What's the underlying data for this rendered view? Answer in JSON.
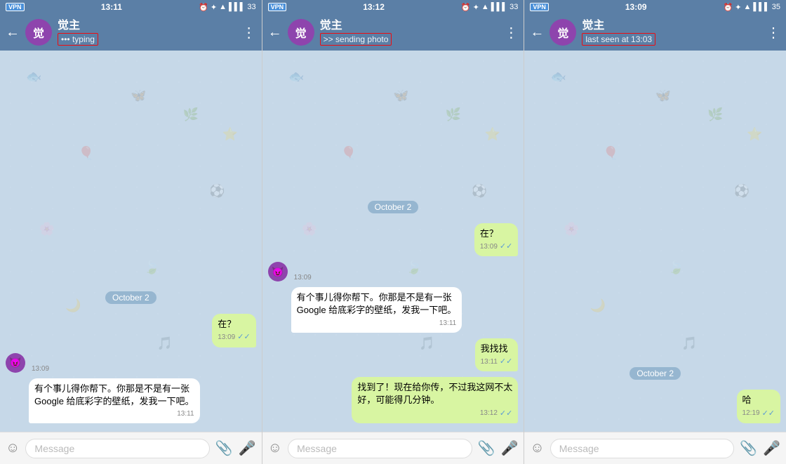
{
  "panels": [
    {
      "id": "panel1",
      "statusBar": {
        "left": "VPN",
        "time": "13:11",
        "right": "33"
      },
      "header": {
        "name": "觉主",
        "avatarChar": "觉",
        "statusText": "••• typing",
        "statusHighlight": true
      },
      "dateSep": "October 2",
      "messages": [
        {
          "type": "sent",
          "text": "在？",
          "time": "13:09",
          "checked": true
        },
        {
          "type": "received",
          "hasAvatar": true,
          "avatarEmoji": "😈",
          "time": "13:09",
          "text": null
        },
        {
          "type": "received",
          "hasAvatar": false,
          "text": "有个事儿得你帮下。你那是不是有一张\nGoogle 给底彩字的壁纸，发我一下吧。",
          "time": "13:11",
          "checked": true
        }
      ],
      "inputPlaceholder": "Message"
    },
    {
      "id": "panel2",
      "statusBar": {
        "left": "VPN",
        "time": "13:12",
        "right": "33"
      },
      "header": {
        "name": "觉主",
        "avatarChar": "觉",
        "statusText": ">> sending photo",
        "statusHighlight": true
      },
      "dateSep": "October 2",
      "messages": [
        {
          "type": "sent",
          "text": "在？",
          "time": "13:09",
          "checked": true
        },
        {
          "type": "received",
          "hasAvatar": true,
          "avatarEmoji": "😈",
          "time": "13:09",
          "text": null
        },
        {
          "type": "received",
          "hasAvatar": false,
          "text": "有个事儿得你帮下。你那是不是有一张\nGoogle 给底彩字的壁纸，发我一下吧。",
          "time": "13:11",
          "checked": true
        },
        {
          "type": "sent",
          "text": "我找找",
          "time": "13:11",
          "checked": false
        },
        {
          "type": "sent",
          "text": "找到了！现在给你传，不过我这网不太\n好，可能得几分钟。",
          "time": "13:12",
          "checked": false
        }
      ],
      "inputPlaceholder": "Message"
    },
    {
      "id": "panel3",
      "statusBar": {
        "left": "VPN",
        "time": "13:09",
        "right": "35"
      },
      "header": {
        "name": "觉主",
        "avatarChar": "觉",
        "statusText": "last seen at 13:03",
        "statusHighlight": true
      },
      "dateSep": "October 2",
      "messages": [
        {
          "type": "sent",
          "text": "哈",
          "time": "12:19",
          "checked": false
        }
      ],
      "inputPlaceholder": "Message"
    }
  ],
  "icons": {
    "back": "←",
    "dots": "⋮",
    "emoji": "☺",
    "attach": "📎",
    "mic": "🎤"
  }
}
